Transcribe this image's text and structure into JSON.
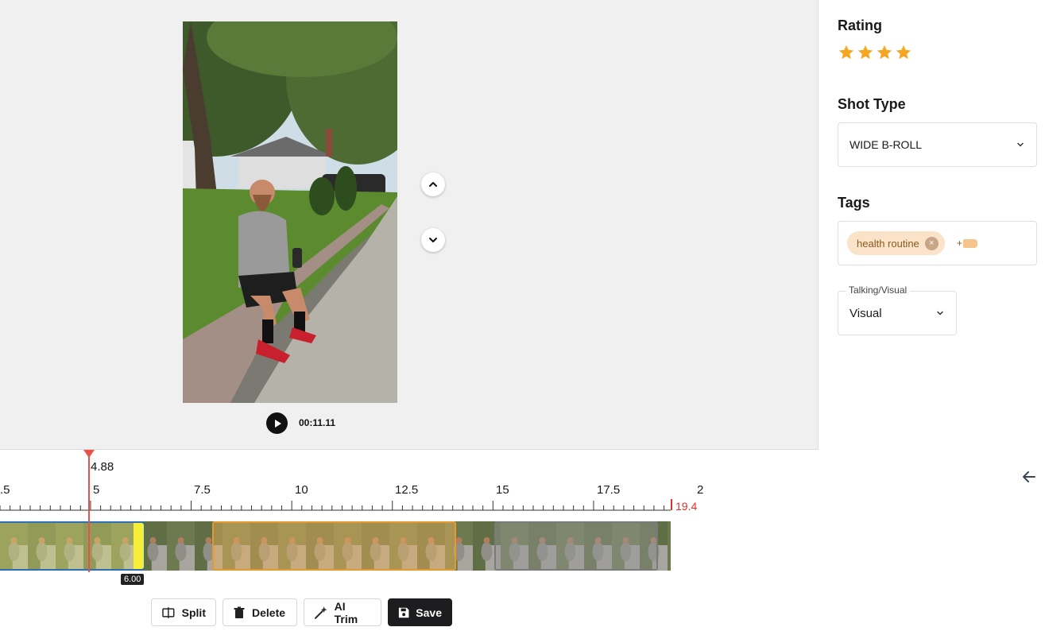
{
  "preview": {
    "time": "00:11.11"
  },
  "panel": {
    "rating_heading": "Rating",
    "rating_value": 4,
    "rating_max": 4,
    "shot_type_heading": "Shot Type",
    "shot_type_value": "WIDE B-ROLL",
    "tags_heading": "Tags",
    "tags": [
      "health routine"
    ],
    "tag_remove": "×",
    "tag_add": "+",
    "talking_visual_label": "Talking/Visual",
    "talking_visual_value": "Visual"
  },
  "timeline": {
    "playhead": "4.88",
    "end_marker": "19.4",
    "tick_labels": [
      ".5",
      "5",
      "7.5",
      "10",
      "12.5",
      "15",
      "17.5",
      "2"
    ],
    "selected_clip_end": "6.00"
  },
  "toolbar": {
    "split": "Split",
    "delete": "Delete",
    "ai_trim": "AI Trim",
    "save": "Save"
  },
  "colors": {
    "star": "#f5a623",
    "playhead": "#e8524a",
    "end_marker": "#e0312f",
    "clip_selected_border": "#2f6fb5",
    "clip_orange_border": "#e69a2e",
    "trim_handle": "#f7ee3a"
  }
}
